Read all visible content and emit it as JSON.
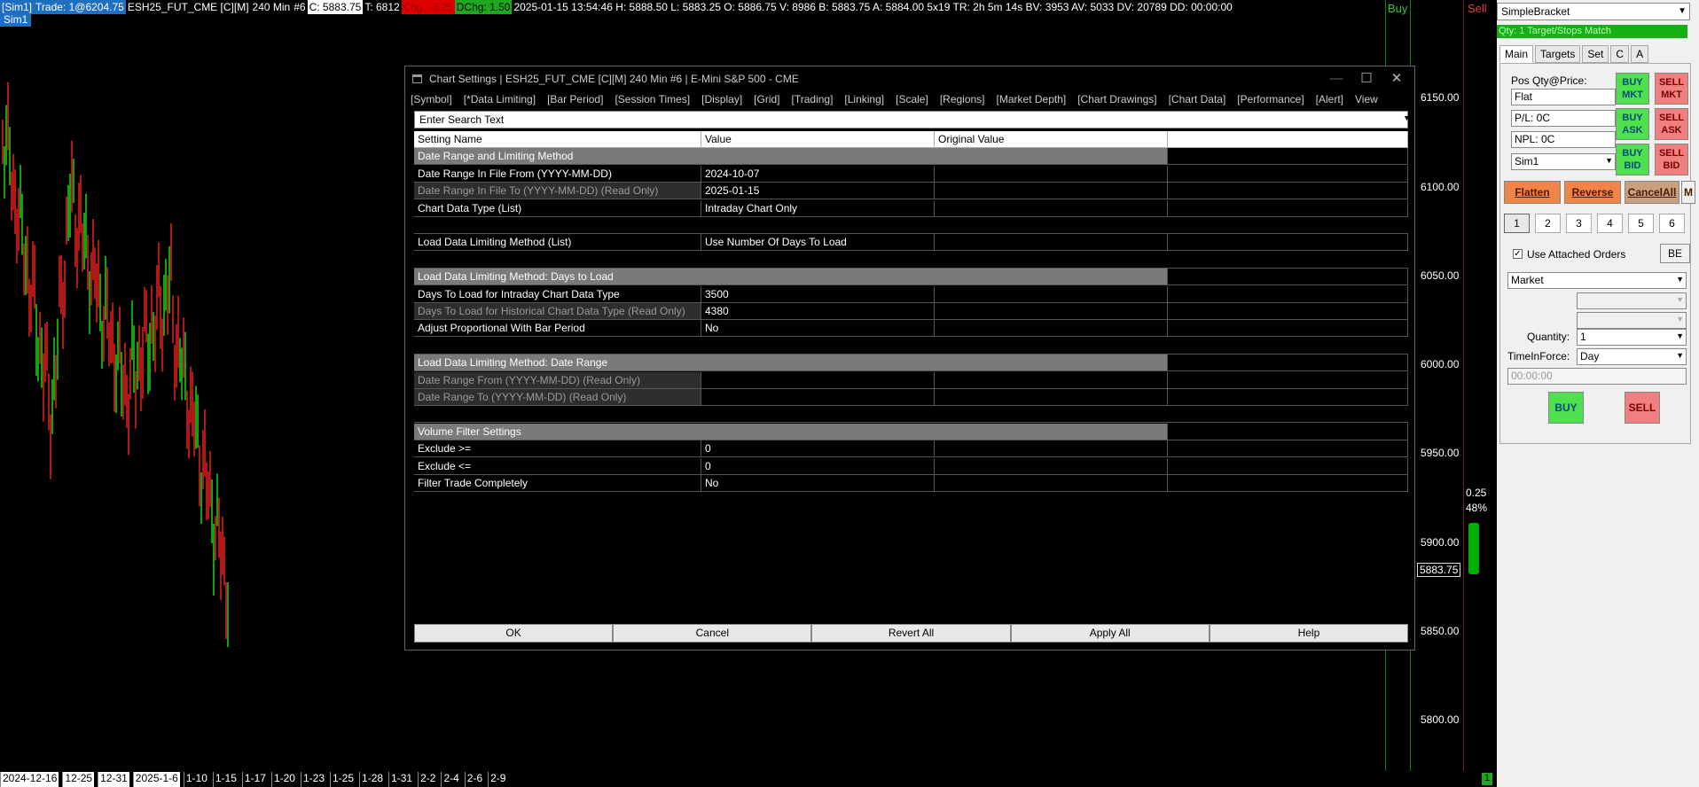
{
  "infobar": {
    "sim": "[Sim1]",
    "trade": "Trade: 1@6204.75",
    "symbol": "ESH25_FUT_CME [C][M]",
    "period": "240 Min",
    "num": "#6",
    "close": "C: 5883.75",
    "ticks": "T: 6812",
    "chg": "Chg: -3.25",
    "dchg": "DChg: 1.50",
    "details": "2025-01-15 13:54:46 H: 5888.50 L: 5883.25 O: 5886.75 V: 8986 B: 5883.75 A: 5884.00 5x19 TR: 2h 5m 14s BV: 3953 AV: 5033 DV: 20789 DD: 00:00:00"
  },
  "sim_tag": "Sim1",
  "chart": {
    "price_labels": [
      "6150.00",
      "6100.00",
      "6050.00",
      "6000.00",
      "5950.00",
      "5900.00",
      "5850.00",
      "5800.00"
    ],
    "last_price": "5883.75",
    "date_labels": [
      "2024-12-16",
      "12-25",
      "12-31",
      "2025-1-6",
      "1-10",
      "1-15",
      "1-17",
      "1-20",
      "1-23",
      "1-25",
      "1-28",
      "1-31",
      "2-2",
      "2-4",
      "2-6",
      "2-9"
    ],
    "buy_label": "Buy",
    "sell_label": "Sell",
    "dom_value": "0.25",
    "dom_pct": "48%",
    "bottom_marker": "1",
    "colors": {
      "up": "#19d919",
      "down": "#e82020"
    }
  },
  "dialog": {
    "title": "Chart Settings | ESH25_FUT_CME [C][M]  240 Min  #6 | E-Mini S&P 500 - CME",
    "tabs": [
      "[Symbol]",
      "[*Data Limiting]",
      "[Bar Period]",
      "[Session Times]",
      "[Display]",
      "[Grid]",
      "[Trading]",
      "[Linking]",
      "[Scale]",
      "[Regions]",
      "[Market Depth]",
      "[Chart Drawings]",
      "[Chart Data]",
      "[Performance]",
      "[Alert]",
      "View"
    ],
    "search_placeholder": "Enter Search Text",
    "headers": {
      "name": "Setting Name",
      "value": "Value",
      "original": "Original Value"
    },
    "rows": [
      {
        "kind": "section",
        "name": "Date Range and Limiting Method"
      },
      {
        "kind": "row",
        "name": "Date Range In File From (YYYY-MM-DD)",
        "value": "2024-10-07"
      },
      {
        "kind": "ro",
        "name": "Date Range In File To (YYYY-MM-DD) (Read Only)",
        "value": "2025-01-15"
      },
      {
        "kind": "row",
        "name": "Chart Data Type (List)",
        "value": "Intraday Chart Only"
      },
      {
        "kind": "blank"
      },
      {
        "kind": "row",
        "name": "Load Data Limiting Method (List)",
        "value": "Use Number Of Days To Load"
      },
      {
        "kind": "blank"
      },
      {
        "kind": "section",
        "name": "Load Data Limiting Method: Days to Load"
      },
      {
        "kind": "row",
        "name": "Days To Load for Intraday Chart Data Type",
        "value": "3500"
      },
      {
        "kind": "ro",
        "name": "Days To Load for Historical Chart Data Type (Read Only)",
        "value": "4380"
      },
      {
        "kind": "row",
        "name": "Adjust Proportional With Bar Period",
        "value": "No"
      },
      {
        "kind": "blank"
      },
      {
        "kind": "section",
        "name": "Load Data Limiting Method: Date Range"
      },
      {
        "kind": "ro",
        "name": "Date Range From (YYYY-MM-DD) (Read Only)",
        "value": ""
      },
      {
        "kind": "ro",
        "name": "Date Range To (YYYY-MM-DD) (Read Only)",
        "value": ""
      },
      {
        "kind": "blank"
      },
      {
        "kind": "section",
        "name": "Volume Filter Settings"
      },
      {
        "kind": "row",
        "name": "Exclude >=",
        "value": "0"
      },
      {
        "kind": "row",
        "name": "Exclude <=",
        "value": "0"
      },
      {
        "kind": "row",
        "name": "Filter Trade Completely",
        "value": "No"
      }
    ],
    "buttons": {
      "ok": "OK",
      "cancel": "Cancel",
      "revert": "Revert All",
      "apply": "Apply All",
      "help": "Help"
    }
  },
  "panel": {
    "strategy": "SimpleBracket",
    "qty_banner": "Qty: 1 Target/Stops Match",
    "tabs": [
      "Main",
      "Targets",
      "Set",
      "C",
      "A"
    ],
    "pos_label": "Pos Qty@Price:",
    "pos_value": "Flat",
    "pl_value": "P/L: 0C",
    "npl_value": "NPL: 0C",
    "account": "Sim1",
    "buy_mkt": [
      "BUY",
      "MKT"
    ],
    "sell_mkt": [
      "SELL",
      "MKT"
    ],
    "buy_ask": [
      "BUY",
      "ASK"
    ],
    "sell_ask": [
      "SELL",
      "ASK"
    ],
    "buy_bid": [
      "BUY",
      "BID"
    ],
    "sell_bid": [
      "SELL",
      "BID"
    ],
    "flatten": "Flatten",
    "reverse": "Reverse",
    "cancel_all": "CancelAll",
    "m_btn": "M",
    "numbers": [
      "1",
      "2",
      "3",
      "4",
      "5",
      "6"
    ],
    "use_attached": "Use Attached Orders",
    "be": "BE",
    "order_type": "Market",
    "quantity_label": "Quantity:",
    "quantity": "1",
    "tif_label": "TimeInForce:",
    "tif": "Day",
    "time_value": "00:00:00",
    "buy": "BUY",
    "sell": "SELL"
  }
}
